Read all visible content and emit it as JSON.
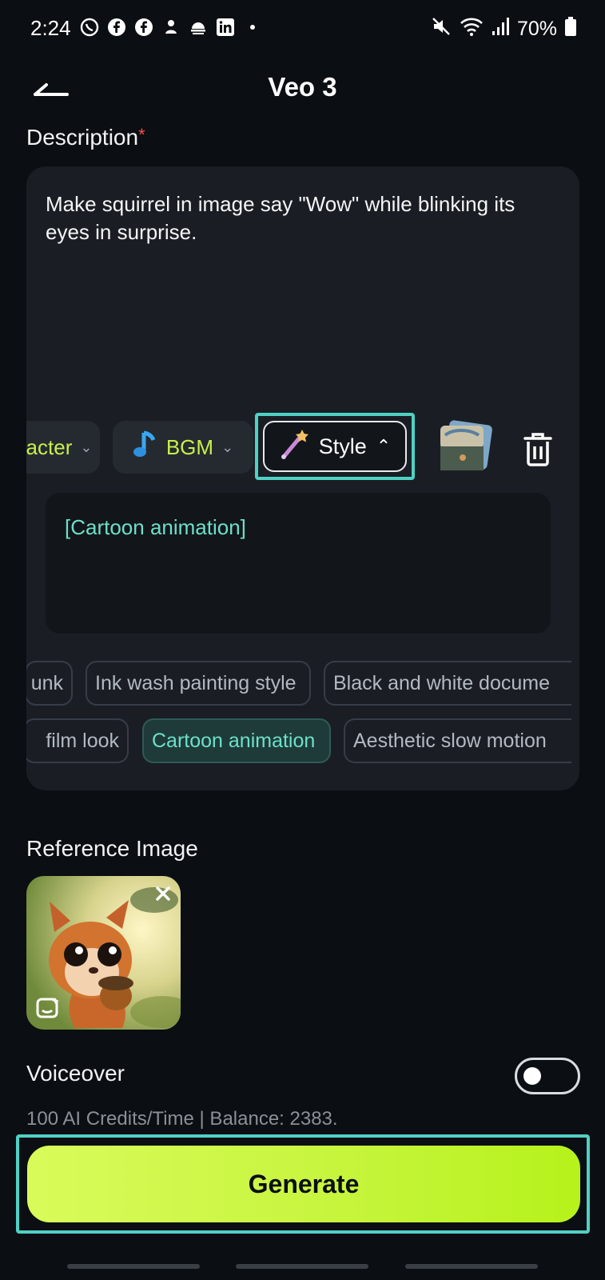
{
  "status_bar": {
    "time": "2:24",
    "battery": "70%",
    "notification_icons": [
      "whatsapp-icon",
      "facebook-icon",
      "facebook-icon",
      "app-icon",
      "cloud-icon",
      "linkedin-icon",
      "dot-icon"
    ]
  },
  "header": {
    "title": "Veo 3"
  },
  "description": {
    "label": "Description",
    "required_mark": "*",
    "text": "Make squirrel in image say \"Wow\" while blinking its eyes in surprise."
  },
  "toolbar": {
    "character_label": "acter",
    "bgm_label": "BGM",
    "style_label": "Style"
  },
  "style_panel": {
    "selected_text": "[Cartoon animation]",
    "row1": [
      "unk",
      "Ink wash painting style",
      "Black and white docume"
    ],
    "row2": [
      "film look",
      "Cartoon animation",
      "Aesthetic slow motion"
    ],
    "selected": "Cartoon animation"
  },
  "reference": {
    "label": "Reference Image"
  },
  "voiceover": {
    "label": "Voiceover",
    "enabled": false
  },
  "credits": {
    "text": "100 AI Credits/Time | Balance: 2383."
  },
  "generate": {
    "label": "Generate"
  },
  "colors": {
    "accent": "#c8f04a",
    "teal": "#6ee0c8",
    "highlight": "#4fd1c5",
    "background": "#0b0e12"
  }
}
